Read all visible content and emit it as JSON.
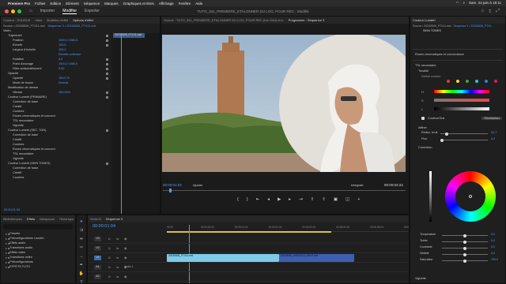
{
  "menubar": {
    "app": "Premiere Pro",
    "items": [
      "Fichier",
      "Edition",
      "Elément",
      "Séquence",
      "Marques",
      "Graphiques et titres",
      "Affichage",
      "Fenêtre",
      "Aide"
    ],
    "clock": "Sam. 24 juin à 15:11"
  },
  "topbar": {
    "tabs": [
      "Importer",
      "Modifier",
      "Exporter"
    ],
    "active_tab": "Modifier",
    "file_title": "TUTO_341_PREMIERE_ETALONNER DU LOG, POUR REC - Modifié"
  },
  "effect_controls": {
    "tabs": [
      "Couleur : SOURCE",
      "Infos",
      "Modèles d'effet",
      "Options d'effet"
    ],
    "source_path": "Source • 20230526_FTX11.mxl",
    "sequence_path": "Séquence 3 • 20230526_FTX11.mxl",
    "clip_tag": "20230526_FTX11.mxl",
    "section_video": "Vidéo",
    "rows": [
      {
        "label": "Trajectoire",
        "value": "",
        "indent": 1,
        "kf": true
      },
      {
        "label": "Position",
        "value": "1920,0  1080,0",
        "indent": 2,
        "kf": true
      },
      {
        "label": "Échelle",
        "value": "100,0",
        "indent": 2,
        "kf": true
      },
      {
        "label": "Largeur d'échelle",
        "value": "100,0",
        "indent": 2,
        "kf": false
      },
      {
        "label": "",
        "value": "Échelle uniforme",
        "indent": 3,
        "kf": false
      },
      {
        "label": "Rotation",
        "value": "0,0",
        "indent": 2,
        "kf": true
      },
      {
        "label": "Point d'ancrage",
        "value": "1920,0  1080,0",
        "indent": 2,
        "kf": true
      },
      {
        "label": "Filtre antiscintillement",
        "value": "0,00",
        "indent": 2,
        "kf": true
      },
      {
        "label": "Opacité",
        "value": "",
        "indent": 1,
        "kf": true
      },
      {
        "label": "Opacité",
        "value": "100,0 %",
        "indent": 2,
        "kf": true
      },
      {
        "label": "Mode de fusion",
        "value": "Normal",
        "indent": 2,
        "kf": false
      },
      {
        "label": "Modification de vitesse",
        "value": "",
        "indent": 1,
        "kf": false
      },
      {
        "label": "Vitesse",
        "value": "100,00%",
        "indent": 2,
        "kf": true
      },
      {
        "label": "Couleur Lumetri (PRIMAIRE)",
        "value": "",
        "indent": 1,
        "kf": true
      },
      {
        "label": "Correction de base",
        "value": "",
        "indent": 2,
        "kf": false
      },
      {
        "label": "Créatif",
        "value": "",
        "indent": 2,
        "kf": false
      },
      {
        "label": "Courbes",
        "value": "",
        "indent": 2,
        "kf": false
      },
      {
        "label": "Roues chromatiques et concord.",
        "value": "",
        "indent": 2,
        "kf": false
      },
      {
        "label": "TSL secondaire",
        "value": "",
        "indent": 2,
        "kf": false
      },
      {
        "label": "Vignette",
        "value": "",
        "indent": 2,
        "kf": false
      },
      {
        "label": "Couleur Lumetri (SEC. TON)",
        "value": "",
        "indent": 1,
        "kf": true
      },
      {
        "label": "Correction de base",
        "value": "",
        "indent": 2,
        "kf": false
      },
      {
        "label": "Créatif",
        "value": "",
        "indent": 2,
        "kf": false
      },
      {
        "label": "Courbes",
        "value": "",
        "indent": 2,
        "kf": false
      },
      {
        "label": "Roues chromatiques et concord.",
        "value": "",
        "indent": 2,
        "kf": false
      },
      {
        "label": "TSL secondaire",
        "value": "",
        "indent": 2,
        "kf": false
      },
      {
        "label": "Vignette",
        "value": "",
        "indent": 2,
        "kf": false
      },
      {
        "label": "Couleur Lumetri (SKIN TONES)",
        "value": "",
        "indent": 1,
        "kf": true
      },
      {
        "label": "Correction de base",
        "value": "",
        "indent": 2,
        "kf": false
      },
      {
        "label": "Créatif",
        "value": "",
        "indent": 2,
        "kf": false
      },
      {
        "label": "Courbes",
        "value": "",
        "indent": 2,
        "kf": false
      }
    ],
    "timecode": "00:00:01:04"
  },
  "program_monitor": {
    "tabs": [
      "Source : TUTO_341_PREMIERE_ETALONNER DU LOG, POUR REC (the Grid).mov",
      "Programme : Séquence 3"
    ],
    "timecode_left": "00:00:01:04",
    "fit": "Ajuster",
    "quality": "Intégrale",
    "timecode_right": "00:00:04:24"
  },
  "project": {
    "tabs": [
      "Bibliothèques",
      "Effets",
      "Marqueurs",
      "Historique"
    ],
    "items": [
      "Presets",
      "Préconfigurations Lumetri",
      "Effets audio",
      "Transitions audio",
      "Effets vidéo",
      "Transitions vidéo",
      "Préconfigurations",
      "EFFETS TUTO"
    ]
  },
  "timeline": {
    "tabs": [
      "Série03",
      "Séquence 3"
    ],
    "timecode": "00:00:01:04",
    "ruler": [
      "00:00",
      "00:00:00:24",
      "00:00:01:24",
      "00:00:02:24",
      "00:00:03:24",
      "00:00:04:24",
      "00:00:05:24",
      "00:00:06:24"
    ],
    "tracks": [
      "V3",
      "V2",
      "V1",
      "A1",
      "A2"
    ],
    "clips": [
      {
        "label": "20230526_FTX11.mxl",
        "start": 0.0,
        "end": 0.46
      },
      {
        "label": "20230526_A001C013_IN2V2.mxl",
        "start": 0.46,
        "end": 0.77
      }
    ],
    "audio_label": "Audio 1"
  },
  "lumetri": {
    "tabs": [
      "Couleur Lumetri"
    ],
    "path": "Source • 20230526_FTX11.mxl",
    "seq_path": "Séquence 3 • 20230526_FTX1...",
    "preset": "SKIN TONES",
    "sections": {
      "roues": "Roues chromatiques et concordance",
      "tsl": "TSL secondaire",
      "sat": "Tonalité",
      "select": "Définir couleur",
      "affiner": "Affiner",
      "correction": "Correction"
    },
    "hsl_labels": [
      "H",
      "S",
      "L"
    ],
    "color_checkbox": "Couleur/Gris",
    "reset": "Réinitialiser",
    "refine": [
      {
        "label": "Réduc. bruit",
        "value": "20,7",
        "level": 0.14
      },
      {
        "label": "Flou",
        "value": "4,2",
        "level": 0.04
      }
    ],
    "correction_sliders": [
      {
        "label": "Température",
        "value": "0,0",
        "level": 0.5
      },
      {
        "label": "Teinte",
        "value": "0,0",
        "level": 0.5
      },
      {
        "label": "Contraste",
        "value": "0,0",
        "level": 0.5
      },
      {
        "label": "Netteté",
        "value": "0,0",
        "level": 0.5
      },
      {
        "label": "Saturation",
        "value": "100,0",
        "level": 0.5
      }
    ],
    "footer": "Vignette",
    "colors": {
      "accent": "#4c9cf3",
      "ring_mid": "#6a6a6a"
    }
  }
}
